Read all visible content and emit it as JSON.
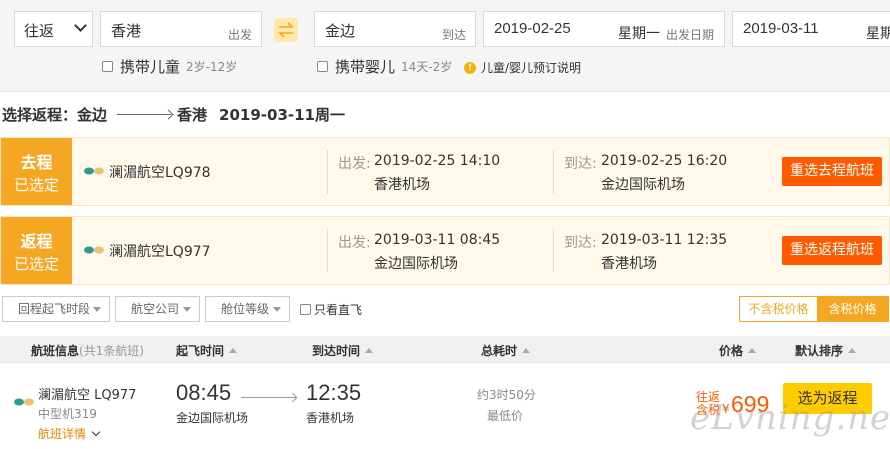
{
  "search": {
    "trip_type": "往返",
    "from_city": "香港",
    "from_hint": "出发",
    "to_city": "金边",
    "to_hint": "到达",
    "depart_date": "2019-02-25",
    "depart_weekday": "星期一",
    "depart_hint": "出发日期",
    "return_date": "2019-03-11",
    "return_weekday": "星期"
  },
  "passengers": {
    "child_label": "携带儿童",
    "child_age": "2岁-12岁",
    "infant_label": "携带婴儿",
    "infant_age": "14天-2岁",
    "info_label": "儿童/婴儿预订说明"
  },
  "heading": {
    "prefix": "选择返程：金边",
    "to": "香港",
    "date": "2019-03-11周一"
  },
  "outbound": {
    "tag1": "去程",
    "tag2": "已选定",
    "airline": "澜湄航空LQ978",
    "dep_label": "出发:",
    "dep_time": "2019-02-25 14:10",
    "dep_airport": "香港机场",
    "arr_label": "到达:",
    "arr_time": "2019-02-25 16:20",
    "arr_airport": "金边国际机场",
    "reselect": "重选去程航班"
  },
  "inbound": {
    "tag1": "返程",
    "tag2": "已选定",
    "airline": "澜湄航空LQ977",
    "dep_label": "出发:",
    "dep_time": "2019-03-11 08:45",
    "dep_airport": "金边国际机场",
    "arr_label": "到达:",
    "arr_time": "2019-03-11 12:35",
    "arr_airport": "香港机场",
    "reselect": "重选返程航班"
  },
  "filters": {
    "f1": "回程起飞时段",
    "f2": "航空公司",
    "f3": "舱位等级",
    "direct": "只看直飞",
    "price_excl": "不含税价格",
    "price_incl": "含税价格"
  },
  "table_head": {
    "flight": "航班信息",
    "count": "(共1条航班)",
    "depart": "起飞时间",
    "arrive": "到达时间",
    "duration": "总耗时",
    "price": "价格",
    "sort": "默认排序"
  },
  "result": {
    "airline": "澜湄航空 LQ977",
    "plane": "中型机319",
    "detail": "航班详情",
    "dep_time": "08:45",
    "dep_airport": "金边国际机场",
    "arr_time": "12:35",
    "arr_airport": "香港机场",
    "duration": "约3时50分",
    "low": "最低价",
    "price_label1": "往返",
    "price_label2": "含税",
    "currency": "¥",
    "price": "699",
    "choose": "选为返程"
  },
  "watermark": "eLvning.net",
  "colors": {
    "accent_orange": "#ff5a00",
    "tag_yellow": "#f5a623",
    "button_yellow": "#ffcc00",
    "segment_bg": "#fff8eb"
  }
}
